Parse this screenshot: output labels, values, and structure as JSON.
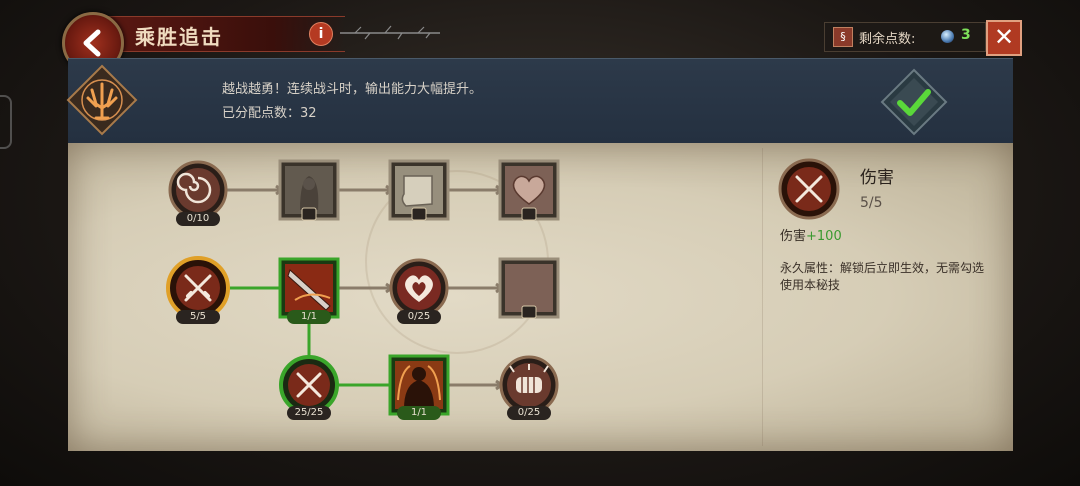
{
  "header": {
    "title": "乘胜追击",
    "info_label": "i",
    "points_label": "剩余点数:",
    "points_value": "3",
    "close_label": "✕"
  },
  "banner": {
    "description": "越战越勇！连续战斗时，输出能力大幅提升。",
    "allocated_label": "已分配点数：",
    "allocated_value": "32"
  },
  "detail": {
    "icon": "crossed-swords-icon",
    "title": "伤害",
    "level": "5/5",
    "stat_label": "伤害",
    "stat_value": "+100",
    "description": "永久属性：解锁后立即生效，无需勾选使用本秘技"
  },
  "skill_nodes": [
    {
      "id": "vortex",
      "icon": "vortex-icon",
      "shape": "round",
      "state": "available",
      "progress": "0/10"
    },
    {
      "id": "bandit",
      "icon": "bandit-portrait-icon",
      "shape": "square",
      "state": "locked",
      "progress": ""
    },
    {
      "id": "scroll",
      "icon": "scroll-icon",
      "shape": "square",
      "state": "locked",
      "progress": ""
    },
    {
      "id": "heart-square",
      "icon": "heart-icon",
      "shape": "square",
      "state": "locked",
      "progress": ""
    },
    {
      "id": "damage",
      "icon": "crossed-swords-icon",
      "shape": "round",
      "state": "maxed",
      "progress": "5/5"
    },
    {
      "id": "blade",
      "icon": "blade-icon",
      "shape": "square",
      "state": "active",
      "progress": "1/1"
    },
    {
      "id": "heart-round",
      "icon": "heart-icon",
      "shape": "round",
      "state": "available",
      "progress": "0/25"
    },
    {
      "id": "moon",
      "icon": "moon-icon",
      "shape": "square",
      "state": "locked",
      "progress": ""
    },
    {
      "id": "damage2",
      "icon": "crossed-swords-icon",
      "shape": "round",
      "state": "active",
      "progress": "25/25"
    },
    {
      "id": "fire-warrior",
      "icon": "fire-warrior-icon",
      "shape": "square",
      "state": "active",
      "progress": "1/1"
    },
    {
      "id": "fist",
      "icon": "fist-icon",
      "shape": "round",
      "state": "available",
      "progress": "0/25"
    }
  ],
  "colors": {
    "active_link": "#3aa52a",
    "inactive_link": "#8a7c6a",
    "gold_ring": "#e0a028",
    "accent_red": "#b03a22",
    "points_green": "#7ee05a"
  }
}
